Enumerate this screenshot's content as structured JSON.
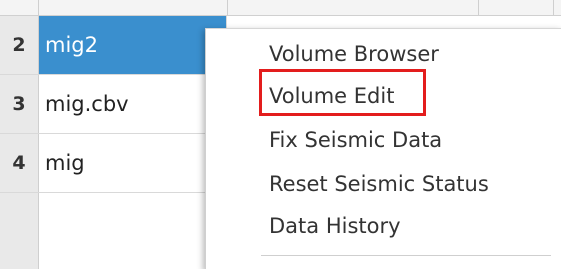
{
  "table": {
    "rows": [
      {
        "num": "2",
        "name": "mig2",
        "selected": true
      },
      {
        "num": "3",
        "name": "mig.cbv",
        "selected": false
      },
      {
        "num": "4",
        "name": "mig",
        "selected": false
      }
    ]
  },
  "context_menu": {
    "items": [
      {
        "label": "Volume Browser"
      },
      {
        "label": "Volume Edit",
        "highlighted": true
      },
      {
        "label": "Fix Seismic Data"
      },
      {
        "label": "Reset Seismic Status"
      },
      {
        "label": "Data History"
      }
    ]
  },
  "colors": {
    "selection": "#3a8fce",
    "highlight_box": "#e31d1d"
  }
}
